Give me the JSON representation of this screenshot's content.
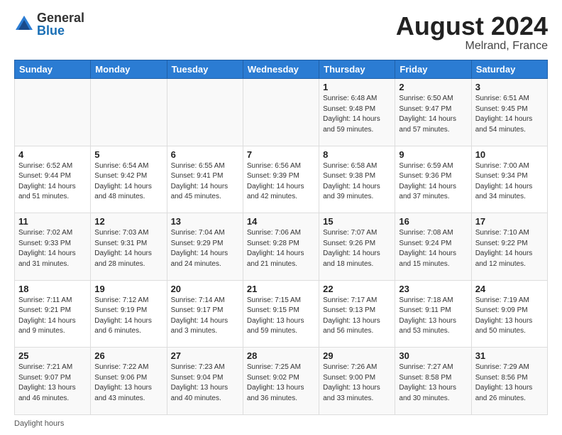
{
  "header": {
    "logo_general": "General",
    "logo_blue": "Blue",
    "month_year": "August 2024",
    "location": "Melrand, France"
  },
  "footer": {
    "daylight_label": "Daylight hours"
  },
  "weekdays": [
    "Sunday",
    "Monday",
    "Tuesday",
    "Wednesday",
    "Thursday",
    "Friday",
    "Saturday"
  ],
  "weeks": [
    [
      {
        "day": "",
        "info": ""
      },
      {
        "day": "",
        "info": ""
      },
      {
        "day": "",
        "info": ""
      },
      {
        "day": "",
        "info": ""
      },
      {
        "day": "1",
        "info": "Sunrise: 6:48 AM\nSunset: 9:48 PM\nDaylight: 14 hours\nand 59 minutes."
      },
      {
        "day": "2",
        "info": "Sunrise: 6:50 AM\nSunset: 9:47 PM\nDaylight: 14 hours\nand 57 minutes."
      },
      {
        "day": "3",
        "info": "Sunrise: 6:51 AM\nSunset: 9:45 PM\nDaylight: 14 hours\nand 54 minutes."
      }
    ],
    [
      {
        "day": "4",
        "info": "Sunrise: 6:52 AM\nSunset: 9:44 PM\nDaylight: 14 hours\nand 51 minutes."
      },
      {
        "day": "5",
        "info": "Sunrise: 6:54 AM\nSunset: 9:42 PM\nDaylight: 14 hours\nand 48 minutes."
      },
      {
        "day": "6",
        "info": "Sunrise: 6:55 AM\nSunset: 9:41 PM\nDaylight: 14 hours\nand 45 minutes."
      },
      {
        "day": "7",
        "info": "Sunrise: 6:56 AM\nSunset: 9:39 PM\nDaylight: 14 hours\nand 42 minutes."
      },
      {
        "day": "8",
        "info": "Sunrise: 6:58 AM\nSunset: 9:38 PM\nDaylight: 14 hours\nand 39 minutes."
      },
      {
        "day": "9",
        "info": "Sunrise: 6:59 AM\nSunset: 9:36 PM\nDaylight: 14 hours\nand 37 minutes."
      },
      {
        "day": "10",
        "info": "Sunrise: 7:00 AM\nSunset: 9:34 PM\nDaylight: 14 hours\nand 34 minutes."
      }
    ],
    [
      {
        "day": "11",
        "info": "Sunrise: 7:02 AM\nSunset: 9:33 PM\nDaylight: 14 hours\nand 31 minutes."
      },
      {
        "day": "12",
        "info": "Sunrise: 7:03 AM\nSunset: 9:31 PM\nDaylight: 14 hours\nand 28 minutes."
      },
      {
        "day": "13",
        "info": "Sunrise: 7:04 AM\nSunset: 9:29 PM\nDaylight: 14 hours\nand 24 minutes."
      },
      {
        "day": "14",
        "info": "Sunrise: 7:06 AM\nSunset: 9:28 PM\nDaylight: 14 hours\nand 21 minutes."
      },
      {
        "day": "15",
        "info": "Sunrise: 7:07 AM\nSunset: 9:26 PM\nDaylight: 14 hours\nand 18 minutes."
      },
      {
        "day": "16",
        "info": "Sunrise: 7:08 AM\nSunset: 9:24 PM\nDaylight: 14 hours\nand 15 minutes."
      },
      {
        "day": "17",
        "info": "Sunrise: 7:10 AM\nSunset: 9:22 PM\nDaylight: 14 hours\nand 12 minutes."
      }
    ],
    [
      {
        "day": "18",
        "info": "Sunrise: 7:11 AM\nSunset: 9:21 PM\nDaylight: 14 hours\nand 9 minutes."
      },
      {
        "day": "19",
        "info": "Sunrise: 7:12 AM\nSunset: 9:19 PM\nDaylight: 14 hours\nand 6 minutes."
      },
      {
        "day": "20",
        "info": "Sunrise: 7:14 AM\nSunset: 9:17 PM\nDaylight: 14 hours\nand 3 minutes."
      },
      {
        "day": "21",
        "info": "Sunrise: 7:15 AM\nSunset: 9:15 PM\nDaylight: 13 hours\nand 59 minutes."
      },
      {
        "day": "22",
        "info": "Sunrise: 7:17 AM\nSunset: 9:13 PM\nDaylight: 13 hours\nand 56 minutes."
      },
      {
        "day": "23",
        "info": "Sunrise: 7:18 AM\nSunset: 9:11 PM\nDaylight: 13 hours\nand 53 minutes."
      },
      {
        "day": "24",
        "info": "Sunrise: 7:19 AM\nSunset: 9:09 PM\nDaylight: 13 hours\nand 50 minutes."
      }
    ],
    [
      {
        "day": "25",
        "info": "Sunrise: 7:21 AM\nSunset: 9:07 PM\nDaylight: 13 hours\nand 46 minutes."
      },
      {
        "day": "26",
        "info": "Sunrise: 7:22 AM\nSunset: 9:06 PM\nDaylight: 13 hours\nand 43 minutes."
      },
      {
        "day": "27",
        "info": "Sunrise: 7:23 AM\nSunset: 9:04 PM\nDaylight: 13 hours\nand 40 minutes."
      },
      {
        "day": "28",
        "info": "Sunrise: 7:25 AM\nSunset: 9:02 PM\nDaylight: 13 hours\nand 36 minutes."
      },
      {
        "day": "29",
        "info": "Sunrise: 7:26 AM\nSunset: 9:00 PM\nDaylight: 13 hours\nand 33 minutes."
      },
      {
        "day": "30",
        "info": "Sunrise: 7:27 AM\nSunset: 8:58 PM\nDaylight: 13 hours\nand 30 minutes."
      },
      {
        "day": "31",
        "info": "Sunrise: 7:29 AM\nSunset: 8:56 PM\nDaylight: 13 hours\nand 26 minutes."
      }
    ]
  ]
}
